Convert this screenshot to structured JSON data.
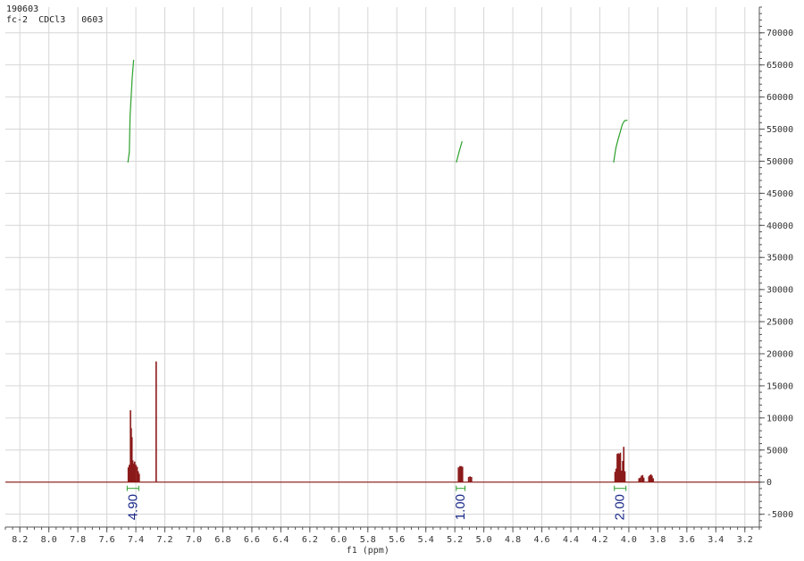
{
  "header": {
    "line1": "190603",
    "line2": "fc-2  CDCl3   0603"
  },
  "chart_data": {
    "type": "line",
    "title": "",
    "xlabel": "f1 (ppm)",
    "ylabel": "",
    "xlim": [
      8.3,
      3.1
    ],
    "ylim": [
      -7000,
      74000
    ],
    "x_ticks": [
      8.2,
      8.0,
      7.8,
      7.6,
      7.4,
      7.2,
      7.0,
      6.8,
      6.6,
      6.4,
      6.2,
      6.0,
      5.8,
      5.6,
      5.4,
      5.2,
      5.0,
      4.8,
      4.6,
      4.4,
      4.2,
      4.0,
      3.8,
      3.6,
      3.4,
      3.2
    ],
    "x_tick_labels": [
      "8.2",
      "8.0",
      "7.8",
      "7.6",
      "7.4",
      "7.2",
      "7.0",
      "6.8",
      "6.6",
      "6.4",
      "6.2",
      "6.0",
      "5.8",
      "5.6",
      "5.4",
      "5.2",
      "5.0",
      "4.8",
      "4.6",
      "4.4",
      "4.2",
      "4.0",
      "3.8",
      "3.6",
      "3.4",
      "3.2"
    ],
    "y_ticks": [
      70000,
      65000,
      60000,
      55000,
      50000,
      45000,
      40000,
      35000,
      30000,
      25000,
      20000,
      15000,
      10000,
      5000,
      0,
      -5000
    ],
    "y_tick_labels": [
      "70000",
      "65000",
      "60000",
      "55000",
      "50000",
      "45000",
      "40000",
      "35000",
      "30000",
      "25000",
      "20000",
      "15000",
      "10000",
      "5000",
      "0",
      "-5000"
    ],
    "grid": true,
    "colors": {
      "spectrum": "#8b1a1a",
      "integral": "#2ca02c",
      "integral_label": "#1a2a8a",
      "grid": "#d6d6d6"
    },
    "series": [
      {
        "peaks": [
          {
            "x": 7.452,
            "y": 2300
          },
          {
            "x": 7.445,
            "y": 2700
          },
          {
            "x": 7.437,
            "y": 11200
          },
          {
            "x": 7.432,
            "y": 8400
          },
          {
            "x": 7.427,
            "y": 7000
          },
          {
            "x": 7.421,
            "y": 3400
          },
          {
            "x": 7.415,
            "y": 2900
          },
          {
            "x": 7.408,
            "y": 3200
          },
          {
            "x": 7.4,
            "y": 2700
          },
          {
            "x": 7.391,
            "y": 2400
          },
          {
            "x": 7.384,
            "y": 1700
          },
          {
            "x": 7.377,
            "y": 1300
          },
          {
            "x": 7.26,
            "y": 18800
          },
          {
            "x": 5.175,
            "y": 2300
          },
          {
            "x": 5.165,
            "y": 2500
          },
          {
            "x": 5.156,
            "y": 2500
          },
          {
            "x": 5.147,
            "y": 2400
          },
          {
            "x": 5.105,
            "y": 800
          },
          {
            "x": 5.095,
            "y": 900
          },
          {
            "x": 5.085,
            "y": 800
          },
          {
            "x": 4.095,
            "y": 1600
          },
          {
            "x": 4.088,
            "y": 2100
          },
          {
            "x": 4.08,
            "y": 4400
          },
          {
            "x": 4.073,
            "y": 4500
          },
          {
            "x": 4.065,
            "y": 4400
          },
          {
            "x": 4.058,
            "y": 4600
          },
          {
            "x": 4.05,
            "y": 1800
          },
          {
            "x": 4.042,
            "y": 3300
          },
          {
            "x": 4.035,
            "y": 5500
          },
          {
            "x": 4.027,
            "y": 1700
          },
          {
            "x": 3.93,
            "y": 600
          },
          {
            "x": 3.922,
            "y": 700
          },
          {
            "x": 3.913,
            "y": 1000
          },
          {
            "x": 3.905,
            "y": 1100
          },
          {
            "x": 3.897,
            "y": 700
          },
          {
            "x": 3.862,
            "y": 900
          },
          {
            "x": 3.855,
            "y": 1100
          },
          {
            "x": 3.847,
            "y": 1200
          },
          {
            "x": 3.84,
            "y": 1000
          },
          {
            "x": 3.832,
            "y": 600
          }
        ]
      }
    ],
    "integrals": [
      {
        "label": "4.90",
        "from": 7.46,
        "to": 7.38,
        "curve": [
          {
            "x": 7.455,
            "y": 49800
          },
          {
            "x": 7.445,
            "y": 51500
          },
          {
            "x": 7.44,
            "y": 57000
          },
          {
            "x": 7.425,
            "y": 63000
          },
          {
            "x": 7.415,
            "y": 65800
          }
        ]
      },
      {
        "label": "1.00",
        "from": 5.19,
        "to": 5.13,
        "curve": [
          {
            "x": 5.19,
            "y": 49800
          },
          {
            "x": 5.17,
            "y": 51500
          },
          {
            "x": 5.15,
            "y": 53100
          }
        ]
      },
      {
        "label": "2.00",
        "from": 4.1,
        "to": 4.02,
        "curve": [
          {
            "x": 4.105,
            "y": 49800
          },
          {
            "x": 4.09,
            "y": 52000
          },
          {
            "x": 4.075,
            "y": 53300
          },
          {
            "x": 4.06,
            "y": 54500
          },
          {
            "x": 4.045,
            "y": 55700
          },
          {
            "x": 4.03,
            "y": 56300
          },
          {
            "x": 4.01,
            "y": 56400
          }
        ]
      }
    ]
  }
}
